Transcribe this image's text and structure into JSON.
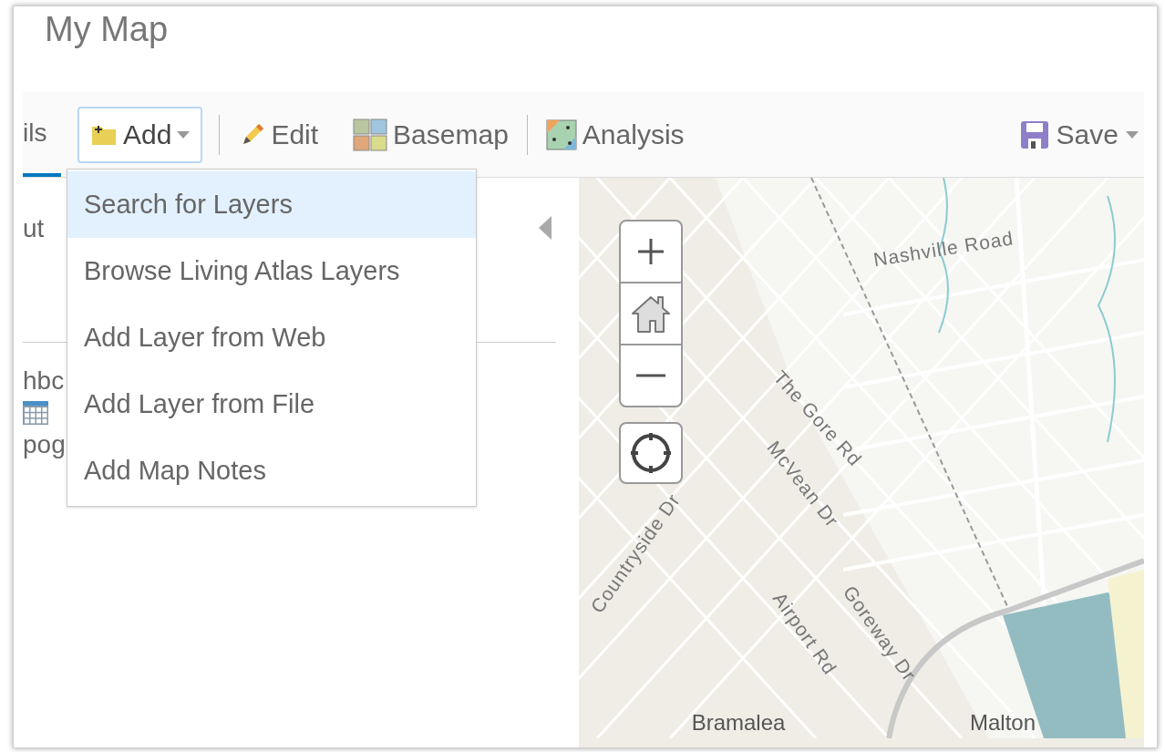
{
  "header": {
    "title": "My Map"
  },
  "toolbar": {
    "items": [
      {
        "kind": "tab",
        "label": "ils",
        "selected": true
      },
      {
        "kind": "dropdown",
        "label": "Add",
        "expanded": true
      },
      {
        "kind": "button",
        "label": "Edit"
      },
      {
        "kind": "button",
        "label": "Basemap"
      },
      {
        "kind": "button",
        "label": "Analysis"
      }
    ],
    "save": {
      "label": "Save"
    }
  },
  "add_menu": {
    "items": [
      {
        "label": "Search for Layers",
        "selected": true
      },
      {
        "label": "Browse Living Atlas Layers",
        "selected": false
      },
      {
        "label": "Add Layer from Web",
        "selected": false
      },
      {
        "label": "Add Layer from File",
        "selected": false
      },
      {
        "label": "Add Map Notes",
        "selected": false
      }
    ]
  },
  "side_panel": {
    "top_text": "ut",
    "layer_texts": [
      "hbc",
      "pog"
    ]
  },
  "map": {
    "labels": [
      "Nashville Road",
      "The Gore Rd",
      "McVean Dr",
      "Countryside Dr",
      "Airport Rd",
      "Goreway Dr",
      "Bramalea",
      "Malton"
    ]
  }
}
